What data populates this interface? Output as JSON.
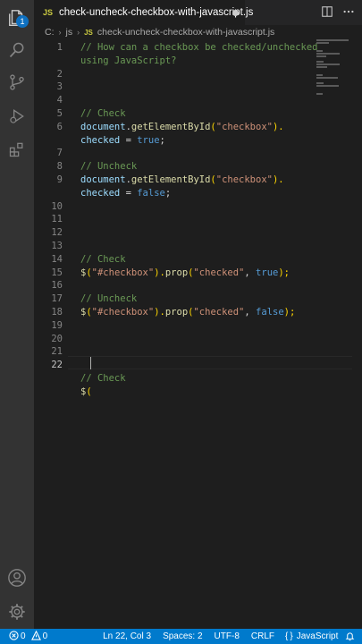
{
  "tab": {
    "badge": "JS",
    "title": "check-uncheck-checkbox-with-javascript.js"
  },
  "activity": {
    "explorer_badge": "1"
  },
  "breadcrumb": {
    "drive": "C:",
    "folder": "js",
    "file_badge": "JS",
    "file": "check-uncheck-checkbox-with-javascript.js"
  },
  "editor": {
    "line_numbers": [
      "1",
      "2",
      "3",
      "4",
      "5",
      "6",
      "7",
      "8",
      "9",
      "10",
      "11",
      "12",
      "13",
      "14",
      "15",
      "16",
      "17",
      "18",
      "19",
      "20",
      "21",
      "22"
    ],
    "lines": [
      {
        "parts": [
          {
            "t": "// How can a checkbox be checked/unchecked",
            "c": "comment"
          }
        ]
      },
      {
        "parts": [
          {
            "t": "using JavaScript?",
            "c": "comment"
          }
        ]
      },
      {
        "parts": []
      },
      {
        "parts": []
      },
      {
        "parts": []
      },
      {
        "parts": [
          {
            "t": "// Check",
            "c": "comment"
          }
        ]
      },
      {
        "parts": [
          {
            "t": "document",
            "c": "var"
          },
          {
            "t": ".",
            "c": "plain"
          },
          {
            "t": "getElementById",
            "c": "fn"
          },
          {
            "t": "(",
            "c": "paren"
          },
          {
            "t": "\"checkbox\"",
            "c": "str"
          },
          {
            "t": ").",
            "c": "paren"
          }
        ]
      },
      {
        "parts": [
          {
            "t": "checked",
            "c": "var"
          },
          {
            "t": " = ",
            "c": "plain"
          },
          {
            "t": "true",
            "c": "kw"
          },
          {
            "t": ";",
            "c": "plain"
          }
        ]
      },
      {
        "parts": []
      },
      {
        "parts": [
          {
            "t": "// Uncheck",
            "c": "comment"
          }
        ]
      },
      {
        "parts": [
          {
            "t": "document",
            "c": "var"
          },
          {
            "t": ".",
            "c": "plain"
          },
          {
            "t": "getElementById",
            "c": "fn"
          },
          {
            "t": "(",
            "c": "paren"
          },
          {
            "t": "\"checkbox\"",
            "c": "str"
          },
          {
            "t": ").",
            "c": "paren"
          }
        ]
      },
      {
        "parts": [
          {
            "t": "checked",
            "c": "var"
          },
          {
            "t": " = ",
            "c": "plain"
          },
          {
            "t": "false",
            "c": "kw"
          },
          {
            "t": ";",
            "c": "plain"
          }
        ]
      },
      {
        "parts": []
      },
      {
        "parts": []
      },
      {
        "parts": []
      },
      {
        "parts": []
      },
      {
        "parts": [
          {
            "t": "// Check",
            "c": "comment"
          }
        ]
      },
      {
        "parts": [
          {
            "t": "$",
            "c": "fn"
          },
          {
            "t": "(",
            "c": "paren"
          },
          {
            "t": "\"#checkbox\"",
            "c": "str"
          },
          {
            "t": ").",
            "c": "paren"
          },
          {
            "t": "prop",
            "c": "fn"
          },
          {
            "t": "(",
            "c": "paren"
          },
          {
            "t": "\"checked\"",
            "c": "str"
          },
          {
            "t": ", ",
            "c": "plain"
          },
          {
            "t": "true",
            "c": "kw"
          },
          {
            "t": ");",
            "c": "paren"
          }
        ]
      },
      {
        "parts": []
      },
      {
        "parts": [
          {
            "t": "// Uncheck",
            "c": "comment"
          }
        ]
      },
      {
        "parts": [
          {
            "t": "$",
            "c": "fn"
          },
          {
            "t": "(",
            "c": "paren"
          },
          {
            "t": "\"#checkbox\"",
            "c": "str"
          },
          {
            "t": ").",
            "c": "paren"
          },
          {
            "t": "prop",
            "c": "fn"
          },
          {
            "t": "(",
            "c": "paren"
          },
          {
            "t": "\"checked\"",
            "c": "str"
          },
          {
            "t": ", ",
            "c": "plain"
          },
          {
            "t": "false",
            "c": "kw"
          },
          {
            "t": ");",
            "c": "paren"
          }
        ]
      },
      {
        "parts": []
      },
      {
        "parts": []
      },
      {
        "parts": []
      },
      {
        "parts": []
      },
      {
        "parts": [
          {
            "t": "// Check",
            "c": "comment"
          }
        ]
      },
      {
        "parts": [
          {
            "t": "$",
            "c": "fn"
          },
          {
            "t": "(",
            "c": "paren"
          }
        ]
      }
    ]
  },
  "status": {
    "errors": "0",
    "warnings": "0",
    "position": "Ln 22, Col 3",
    "spaces": "Spaces: 2",
    "encoding": "UTF-8",
    "eol": "CRLF",
    "language": "JavaScript"
  },
  "colors": {
    "status_bg": "#007acc",
    "editor_bg": "#1e1e1e",
    "activity_bg": "#333333"
  }
}
